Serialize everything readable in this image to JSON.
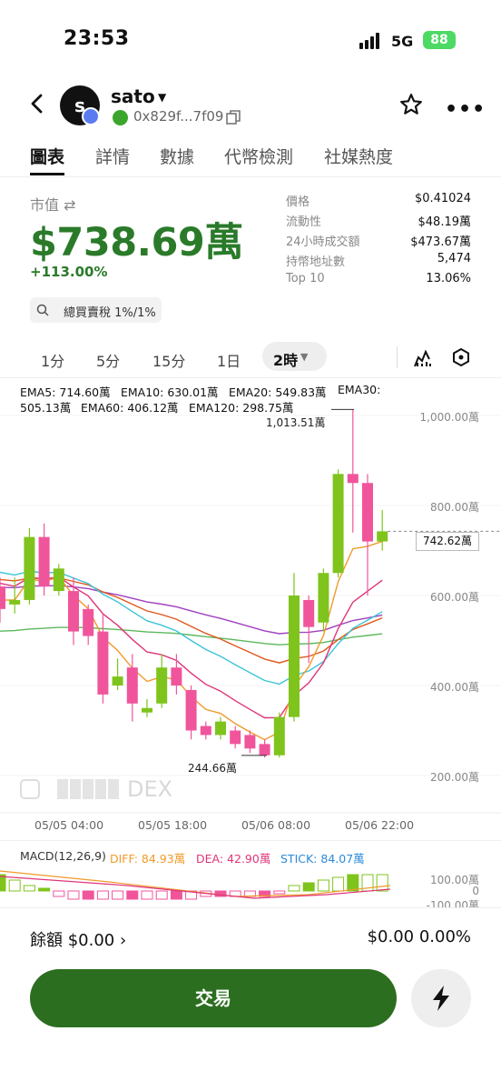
{
  "status": {
    "time": "23:53",
    "network": "5G",
    "battery": "88"
  },
  "token": {
    "avatar_letter": "s",
    "name": "sato",
    "address": "0x829f...7f09"
  },
  "tabs": [
    "圖表",
    "詳情",
    "數據",
    "代幣檢測",
    "社媒熱度"
  ],
  "market": {
    "label": "市值 ⇄",
    "value": "$738.69萬",
    "change": "+113.00%",
    "stats": [
      {
        "label": "價格",
        "value": "$0.41024"
      },
      {
        "label": "流動性",
        "value": "$48.19萬"
      },
      {
        "label": "24小時成交額",
        "value": "$473.67萬"
      },
      {
        "label": "持幣地址數",
        "value": "5,474"
      },
      {
        "label": "Top 10",
        "value": "13.06%"
      }
    ],
    "tax": "總買賣稅 1%/1%"
  },
  "timeframes": {
    "options": [
      "1分",
      "5分",
      "15分",
      "1日"
    ],
    "selected": "2時"
  },
  "chart": {
    "ema": {
      "ema5": "EMA5: 714.60萬",
      "ema10": "EMA10: 630.01萬",
      "ema20": "EMA20: 549.83萬",
      "ema30a": "EMA30:",
      "ema30b": "505.13萬",
      "ema60": "EMA60: 406.12萬",
      "ema120": "EMA120: 298.75萬"
    },
    "y_ticks": [
      "1,000.00萬",
      "800.00萬",
      "600.00萬",
      "400.00萬",
      "200.00萬"
    ],
    "current_price": "742.62萬",
    "high_label": "1,013.51萬",
    "low_label": "244.66萬",
    "x_ticks": [
      "05/05 04:00",
      "05/05 18:00",
      "05/06 08:00",
      "05/06 22:00"
    ],
    "watermark": "DEX",
    "macd": {
      "title": "MACD(12,26,9)",
      "diff": "DIFF: 84.93萬",
      "dea": "DEA: 42.90萬",
      "stick": "STICK: 84.07萬",
      "ticks": [
        "100.00萬",
        "0",
        "-100.00萬"
      ]
    },
    "colors": {
      "up": "#7fc41c",
      "down": "#f0559c",
      "ema5": "#f09a2a",
      "ema10": "#e0347a",
      "ema20": "#3dc4d8",
      "ema30": "#e0581c",
      "ema60": "#a040c0",
      "ema120": "#5cb85c"
    }
  },
  "chart_data": {
    "type": "candlestick",
    "y_unit": "萬",
    "ylim": [
      150,
      1050
    ],
    "candles": [
      {
        "o": 620,
        "c": 570,
        "h": 640,
        "l": 540
      },
      {
        "o": 580,
        "c": 590,
        "h": 640,
        "l": 560
      },
      {
        "o": 590,
        "c": 730,
        "h": 750,
        "l": 580
      },
      {
        "o": 730,
        "c": 620,
        "h": 760,
        "l": 600
      },
      {
        "o": 610,
        "c": 660,
        "h": 670,
        "l": 600
      },
      {
        "o": 610,
        "c": 520,
        "h": 640,
        "l": 490
      },
      {
        "o": 570,
        "c": 510,
        "h": 580,
        "l": 490
      },
      {
        "o": 520,
        "c": 380,
        "h": 560,
        "l": 360
      },
      {
        "o": 400,
        "c": 420,
        "h": 460,
        "l": 390
      },
      {
        "o": 440,
        "c": 360,
        "h": 470,
        "l": 320
      },
      {
        "o": 340,
        "c": 350,
        "h": 370,
        "l": 330
      },
      {
        "o": 360,
        "c": 440,
        "h": 470,
        "l": 350
      },
      {
        "o": 440,
        "c": 400,
        "h": 470,
        "l": 380
      },
      {
        "o": 390,
        "c": 300,
        "h": 400,
        "l": 280
      },
      {
        "o": 310,
        "c": 290,
        "h": 320,
        "l": 280
      },
      {
        "o": 290,
        "c": 320,
        "h": 330,
        "l": 280
      },
      {
        "o": 300,
        "c": 270,
        "h": 310,
        "l": 260
      },
      {
        "o": 290,
        "c": 260,
        "h": 300,
        "l": 250
      },
      {
        "o": 270,
        "c": 245,
        "h": 280,
        "l": 240
      },
      {
        "o": 245,
        "c": 330,
        "h": 340,
        "l": 240
      },
      {
        "o": 330,
        "c": 600,
        "h": 650,
        "l": 320
      },
      {
        "o": 590,
        "c": 530,
        "h": 600,
        "l": 450
      },
      {
        "o": 540,
        "c": 650,
        "h": 660,
        "l": 520
      },
      {
        "o": 650,
        "c": 870,
        "h": 880,
        "l": 640
      },
      {
        "o": 870,
        "c": 850,
        "h": 1013.51,
        "l": 740
      },
      {
        "o": 850,
        "c": 720,
        "h": 870,
        "l": 600
      },
      {
        "o": 720,
        "c": 742.62,
        "h": 790,
        "l": 700
      }
    ],
    "macd_stick": [
      6,
      4,
      2,
      1,
      -2,
      -3,
      -3,
      -3,
      -3,
      -3,
      -3,
      -3,
      -3,
      -3,
      -2,
      -2,
      -2,
      -2,
      -2,
      -1,
      2,
      3,
      4,
      5,
      6,
      6,
      6
    ]
  }
}
